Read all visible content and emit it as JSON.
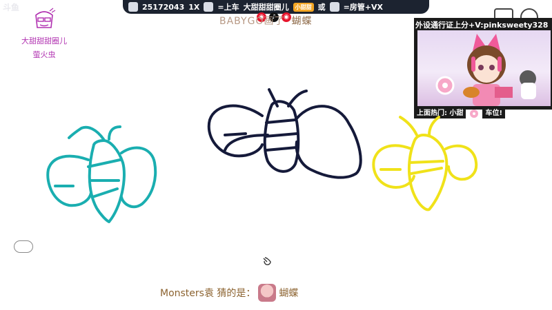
{
  "app": {
    "logo": "斗鱼"
  },
  "streamer": {
    "name": "大甜甜甜圈儿",
    "subtitle": "萤火虫"
  },
  "top_banner": {
    "id_number": "25172043",
    "segment_1": "1X",
    "segment_2": "=上车",
    "segment_3": "大甜甜甜圈儿",
    "badge": "小甜甜",
    "segment_4": "或",
    "segment_5": "=房管+VX"
  },
  "overlay_title": {
    "text": "BABYGO画了",
    "answer": "蝴蝶"
  },
  "cam_panel": {
    "caption": "外设通行证上分+V:pinksweety328",
    "bar_left": "上面热门: 小甜",
    "bar_right": "车位!"
  },
  "guess": {
    "user": "Monsters袁",
    "label": "猜的是：",
    "answer": "蝴蝶"
  },
  "colors": {
    "teal": "#1aaeb0",
    "navy": "#151a3a",
    "yellow": "#f0e21a",
    "purple": "#b030b0"
  }
}
